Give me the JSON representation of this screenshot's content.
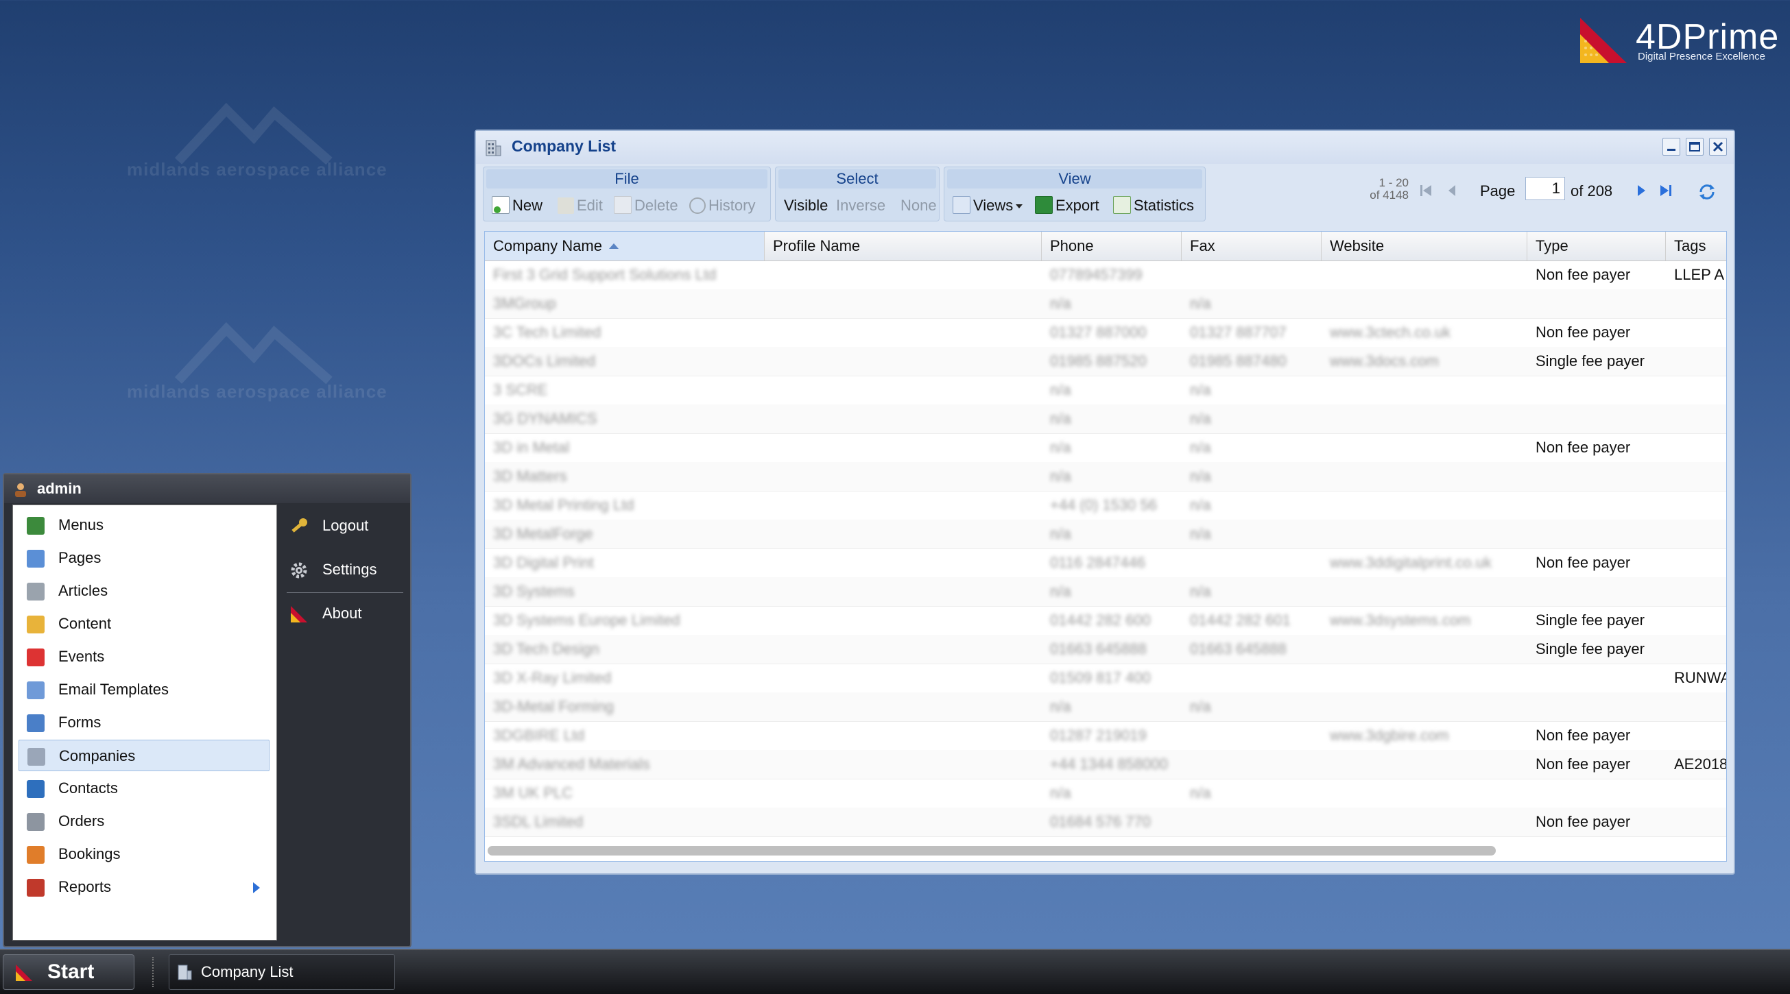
{
  "desktop": {
    "watermark_text": "midlands aerospace alliance",
    "logo": {
      "name": "4DPrime",
      "tagline": "Digital Presence Excellence"
    }
  },
  "window": {
    "title": "Company List",
    "toolbar": {
      "groups": {
        "file": {
          "label": "File",
          "new": "New",
          "edit": "Edit",
          "delete": "Delete",
          "history": "History"
        },
        "select": {
          "label": "Select",
          "visible": "Visible",
          "inverse": "Inverse",
          "none": "None"
        },
        "view": {
          "label": "View",
          "views": "Views",
          "export": "Export",
          "statistics": "Statistics"
        }
      },
      "pager": {
        "range": "1 - 20",
        "total": "of 4148",
        "page_label": "Page",
        "page_value": "1",
        "of_pages": "of 208"
      }
    },
    "grid": {
      "columns": [
        "Company Name",
        "Profile Name",
        "Phone",
        "Fax",
        "Website",
        "Type",
        "Tags"
      ],
      "sorted_column": "Company Name",
      "rows": [
        {
          "company": "First 3 Grid Support Solutions Ltd",
          "profile": "",
          "phone": "07789457399",
          "fax": "",
          "website": "",
          "type": "Non fee payer",
          "tags": "LLEP A"
        },
        {
          "company": "3MGroup",
          "profile": "",
          "phone": "n/a",
          "fax": "n/a",
          "website": "",
          "type": "",
          "tags": ""
        },
        {
          "company": "3C Tech Limited",
          "profile": "",
          "phone": "01327 887000",
          "fax": "01327 887707",
          "website": "www.3ctech.co.uk",
          "type": "Non fee payer",
          "tags": ""
        },
        {
          "company": "3DOCs Limited",
          "profile": "",
          "phone": "01985 887520",
          "fax": "01985 887480",
          "website": "www.3docs.com",
          "type": "Single fee payer",
          "tags": ""
        },
        {
          "company": "3 SCRE",
          "profile": "",
          "phone": "n/a",
          "fax": "n/a",
          "website": "",
          "type": "",
          "tags": ""
        },
        {
          "company": "3G DYNAMICS",
          "profile": "",
          "phone": "n/a",
          "fax": "n/a",
          "website": "",
          "type": "",
          "tags": ""
        },
        {
          "company": "3D in Metal",
          "profile": "",
          "phone": "n/a",
          "fax": "n/a",
          "website": "",
          "type": "Non fee payer",
          "tags": ""
        },
        {
          "company": "3D Matters",
          "profile": "",
          "phone": "n/a",
          "fax": "n/a",
          "website": "",
          "type": "",
          "tags": ""
        },
        {
          "company": "3D Metal Printing Ltd",
          "profile": "",
          "phone": "+44 (0) 1530 56",
          "fax": "n/a",
          "website": "",
          "type": "",
          "tags": ""
        },
        {
          "company": "3D MetalForge",
          "profile": "",
          "phone": "n/a",
          "fax": "n/a",
          "website": "",
          "type": "",
          "tags": ""
        },
        {
          "company": "3D Digital Print",
          "profile": "",
          "phone": "0116 2847446",
          "fax": "",
          "website": "www.3ddigitalprint.co.uk",
          "type": "Non fee payer",
          "tags": ""
        },
        {
          "company": "3D Systems",
          "profile": "",
          "phone": "n/a",
          "fax": "n/a",
          "website": "",
          "type": "",
          "tags": ""
        },
        {
          "company": "3D Systems Europe Limited",
          "profile": "",
          "phone": "01442 282 600",
          "fax": "01442 282 601",
          "website": "www.3dsystems.com",
          "type": "Single fee payer",
          "tags": ""
        },
        {
          "company": "3D Tech Design",
          "profile": "",
          "phone": "01663 645888",
          "fax": "01663 645888",
          "website": "",
          "type": "Single fee payer",
          "tags": ""
        },
        {
          "company": "3D X-Ray Limited",
          "profile": "",
          "phone": "01509 817 400",
          "fax": "",
          "website": "",
          "type": "",
          "tags": "RUNWA"
        },
        {
          "company": "3D-Metal Forming",
          "profile": "",
          "phone": "n/a",
          "fax": "n/a",
          "website": "",
          "type": "",
          "tags": ""
        },
        {
          "company": "3DGBIRE Ltd",
          "profile": "",
          "phone": "01287 219019",
          "fax": "",
          "website": "www.3dgbire.com",
          "type": "Non fee payer",
          "tags": ""
        },
        {
          "company": "3M Advanced Materials",
          "profile": "",
          "phone": "+44 1344 858000",
          "fax": "",
          "website": "",
          "type": "Non fee payer",
          "tags": "AE2018"
        },
        {
          "company": "3M UK PLC",
          "profile": "",
          "phone": "n/a",
          "fax": "n/a",
          "website": "",
          "type": "",
          "tags": ""
        },
        {
          "company": "3SDL Limited",
          "profile": "",
          "phone": "01684 576 770",
          "fax": "",
          "website": "",
          "type": "Non fee payer",
          "tags": ""
        }
      ]
    }
  },
  "start_menu": {
    "user": "admin",
    "items": [
      {
        "label": "Menus",
        "icon": "sitemap-icon"
      },
      {
        "label": "Pages",
        "icon": "page-icon"
      },
      {
        "label": "Articles",
        "icon": "tag-icon"
      },
      {
        "label": "Content",
        "icon": "folder-icon"
      },
      {
        "label": "Events",
        "icon": "calendar-icon"
      },
      {
        "label": "Email Templates",
        "icon": "envelope-icon"
      },
      {
        "label": "Forms",
        "icon": "form-icon"
      },
      {
        "label": "Companies",
        "icon": "building-icon"
      },
      {
        "label": "Contacts",
        "icon": "person-icon"
      },
      {
        "label": "Orders",
        "icon": "cart-icon"
      },
      {
        "label": "Bookings",
        "icon": "grid-icon"
      },
      {
        "label": "Reports",
        "icon": "report-icon"
      }
    ],
    "selected": "Companies",
    "actions": {
      "logout": "Logout",
      "settings": "Settings",
      "about": "About"
    }
  },
  "taskbar": {
    "start": "Start",
    "task": "Company List"
  },
  "colors": {
    "window_title": "#15428b",
    "desktop": "#4b6fa7",
    "selection": "#dbe8f8"
  }
}
